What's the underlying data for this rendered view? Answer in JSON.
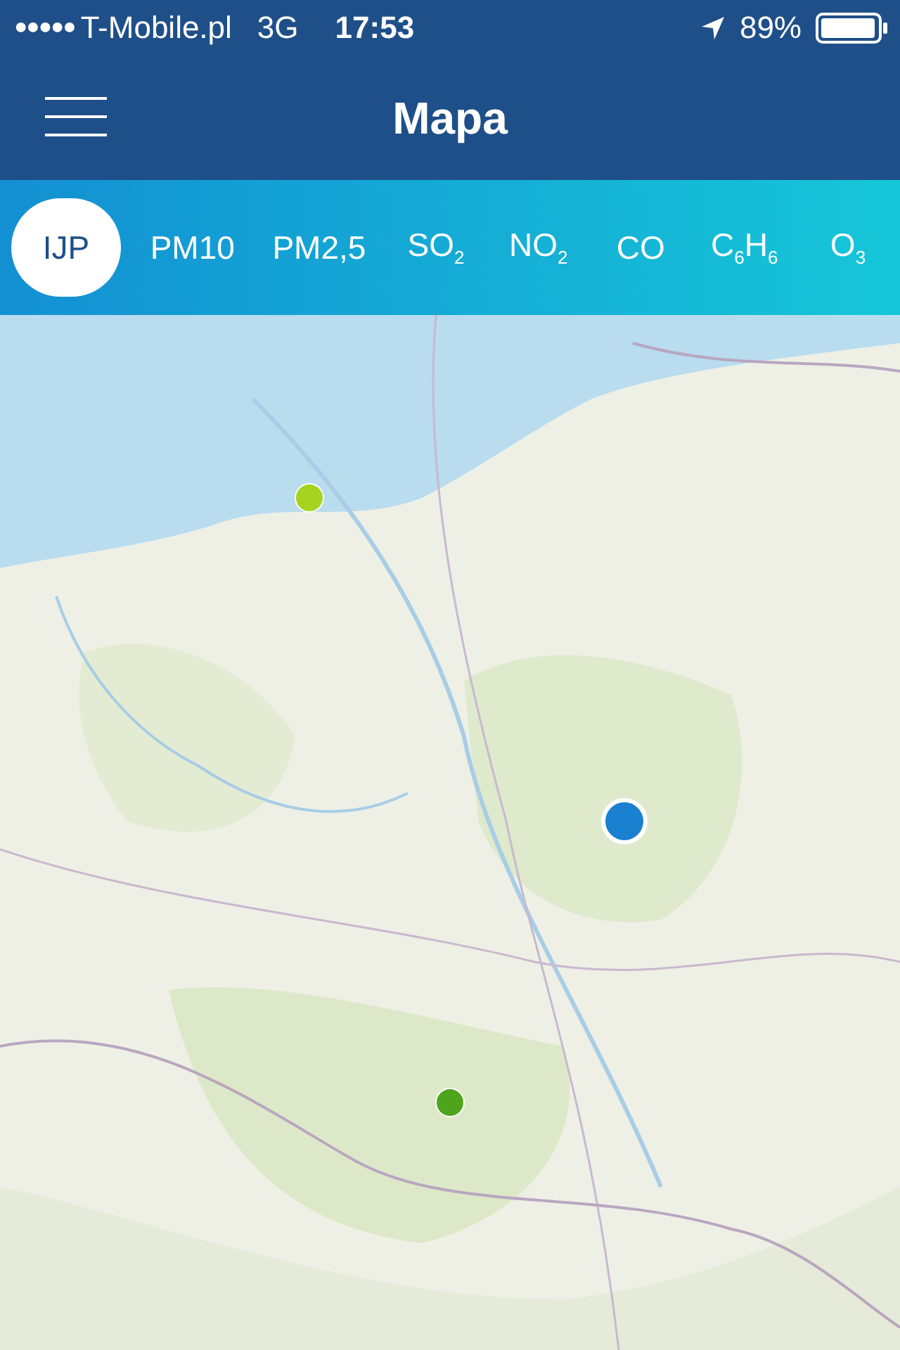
{
  "status_bar": {
    "signal_dots": "●●●●●",
    "carrier": "T-Mobile.pl",
    "network": "3G",
    "time": "17:53",
    "battery": "89%"
  },
  "nav_bar": {
    "title": "Mapa"
  },
  "tabs": [
    {
      "label": "IJP",
      "selected": true
    },
    {
      "label": "PM10",
      "selected": false
    },
    {
      "label": "PM2,5",
      "selected": false
    },
    {
      "label": "SO$_{2}$",
      "selected": false
    },
    {
      "label": "NO$_{2}$",
      "selected": false
    },
    {
      "label": "CO",
      "selected": false
    },
    {
      "label": "C$_{6}$H$_{6}$",
      "selected": false
    },
    {
      "label": "O$_{3}$",
      "selected": false
    }
  ]
}
